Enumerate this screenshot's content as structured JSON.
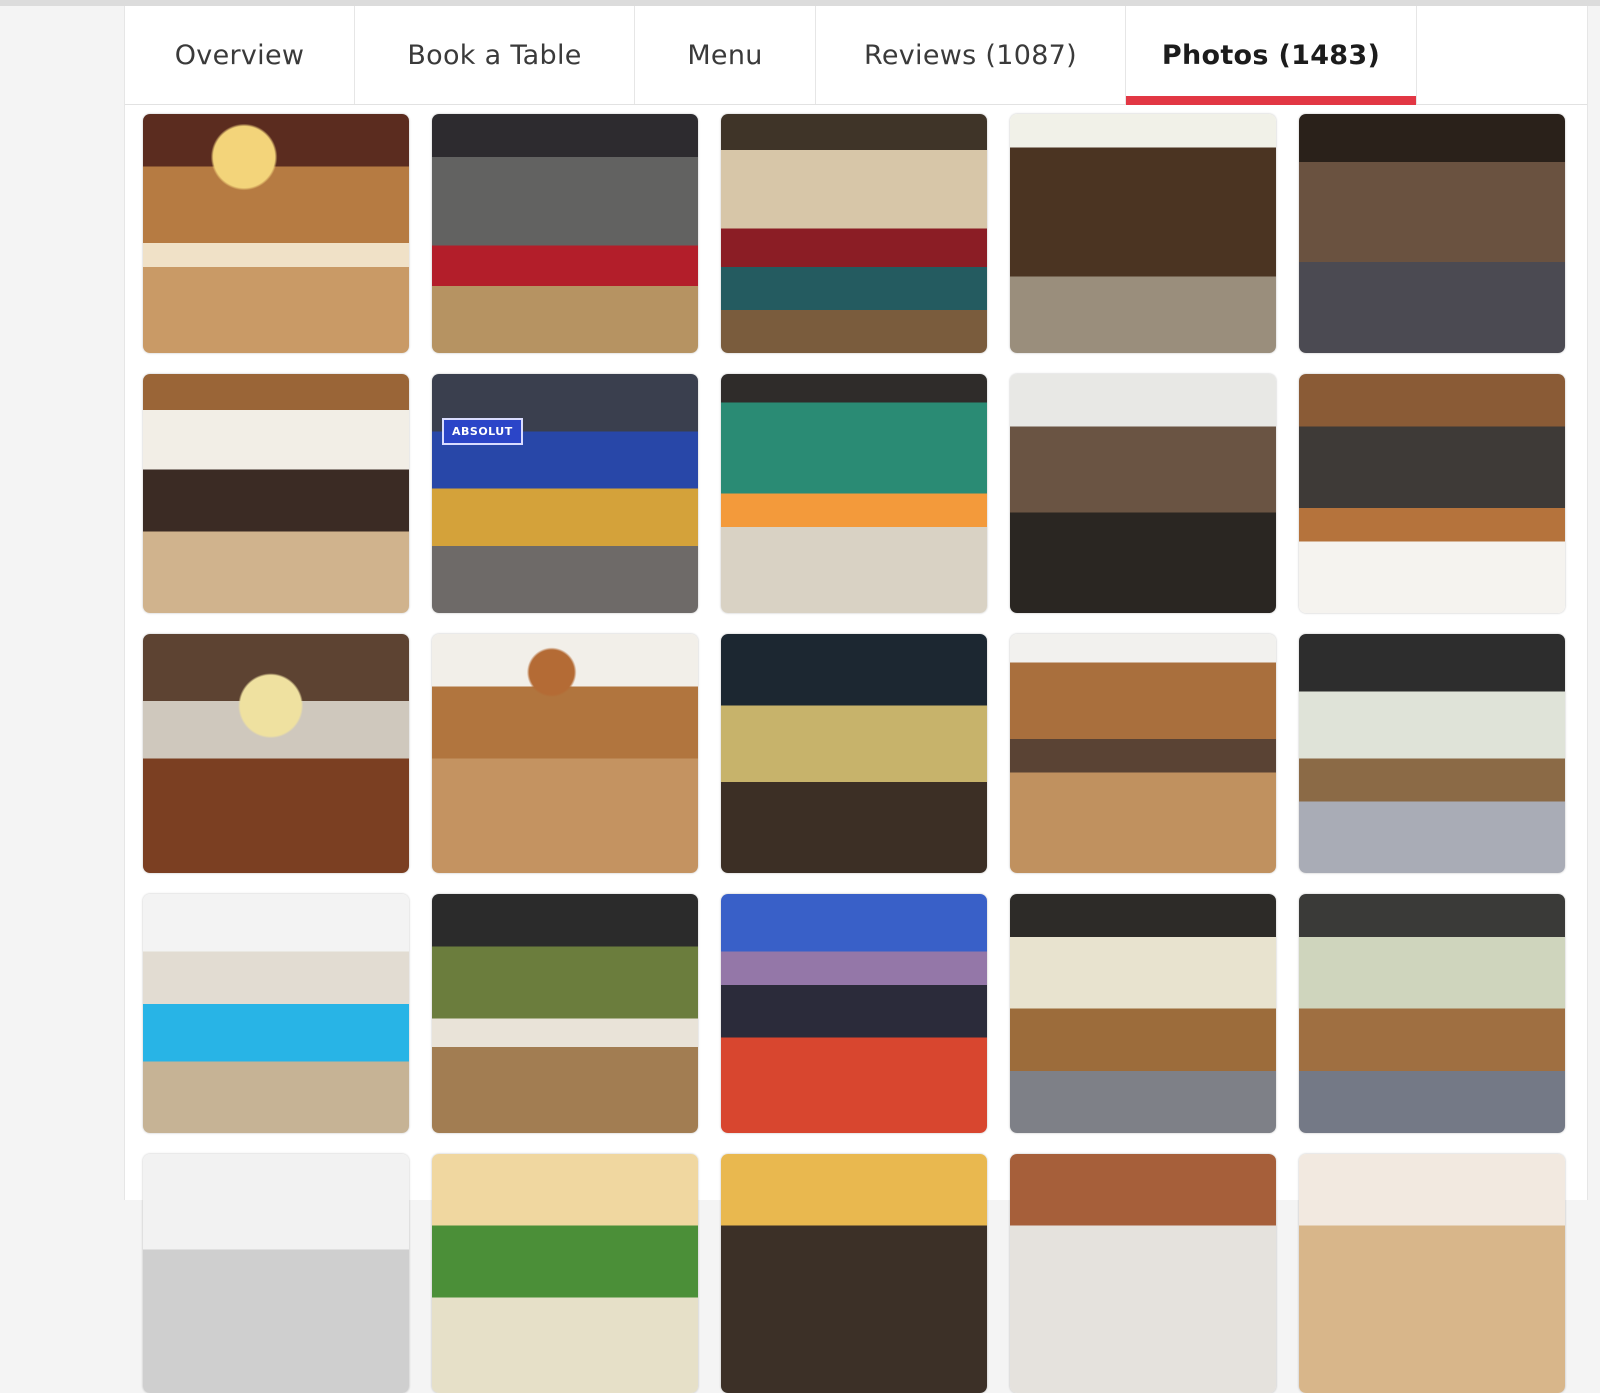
{
  "tabs": [
    {
      "label": "Overview",
      "active": false
    },
    {
      "label": "Book a Table",
      "active": false
    },
    {
      "label": "Menu",
      "active": false
    },
    {
      "label": "Reviews (1087)",
      "active": false
    },
    {
      "label": "Photos (1483)",
      "active": true
    }
  ],
  "accent_color": "#e23744",
  "photos": {
    "rows": [
      [
        "dining-hall-pendant-light",
        "red-sofa-lounge",
        "lounge-with-red-sofa",
        "entrance-wooden-doors",
        "terrace-seating"
      ],
      [
        "dining-area-wooden-beams",
        "absolut-bar-corner",
        "rooftop-terrace-tables",
        "dining-area-wall-art",
        "bar-counter"
      ],
      [
        "long-table-pendant-light",
        "dining-area-chandelier",
        "night-exterior",
        "dining-hall-wooden-floor",
        "covered-terrace"
      ],
      [
        "blue-sofa-lounge",
        "garden-terrace-seating",
        "rooftop-night-view",
        "terrace-wooden-chairs",
        "terrace-dining-tables"
      ],
      [
        "partial-photo-1",
        "partial-photo-2",
        "partial-photo-3",
        "partial-photo-4",
        "partial-photo-5"
      ]
    ],
    "signage": {
      "absolut_sign": "ABSOLUT"
    }
  }
}
